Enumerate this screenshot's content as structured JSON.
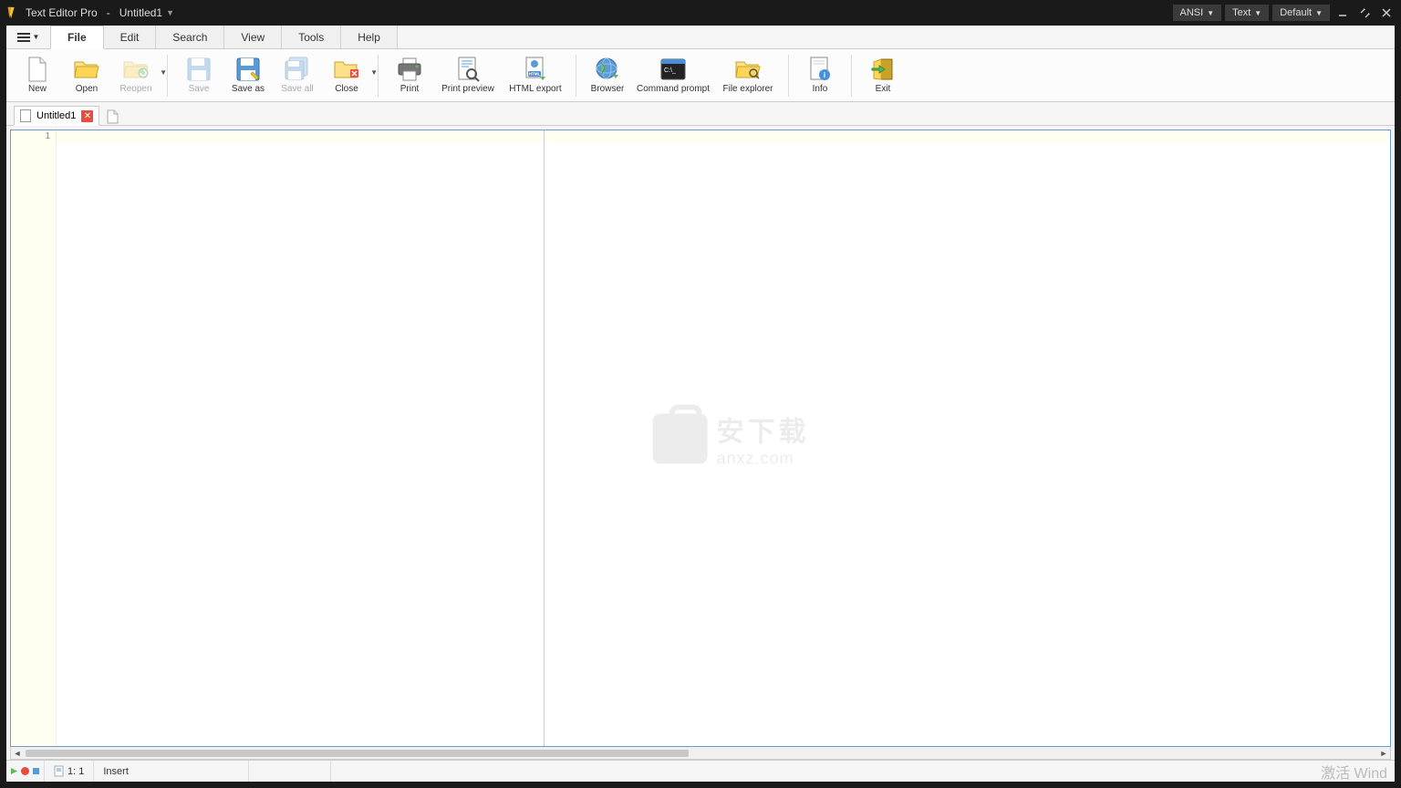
{
  "titlebar": {
    "app_name": "Text Editor Pro",
    "separator": "-",
    "doc_name": "Untitled1",
    "combos": {
      "encoding": "ANSI",
      "type": "Text",
      "theme": "Default"
    }
  },
  "menu": {
    "tabs": [
      "File",
      "Edit",
      "Search",
      "View",
      "Tools",
      "Help"
    ],
    "active": "File"
  },
  "ribbon": {
    "new": "New",
    "open": "Open",
    "reopen": "Reopen",
    "save": "Save",
    "save_as": "Save as",
    "save_all": "Save all",
    "close": "Close",
    "print": "Print",
    "print_preview": "Print preview",
    "html_export": "HTML export",
    "browser": "Browser",
    "cmd": "Command prompt",
    "file_explorer": "File explorer",
    "info": "Info",
    "exit": "Exit"
  },
  "doc_tabs": {
    "tab1": "Untitled1"
  },
  "editor": {
    "line_no": "1"
  },
  "watermark": {
    "cn": "安下载",
    "en": "anxz.com"
  },
  "statusbar": {
    "pos": "1: 1",
    "mode": "Insert",
    "activation": "激活 Wind"
  }
}
